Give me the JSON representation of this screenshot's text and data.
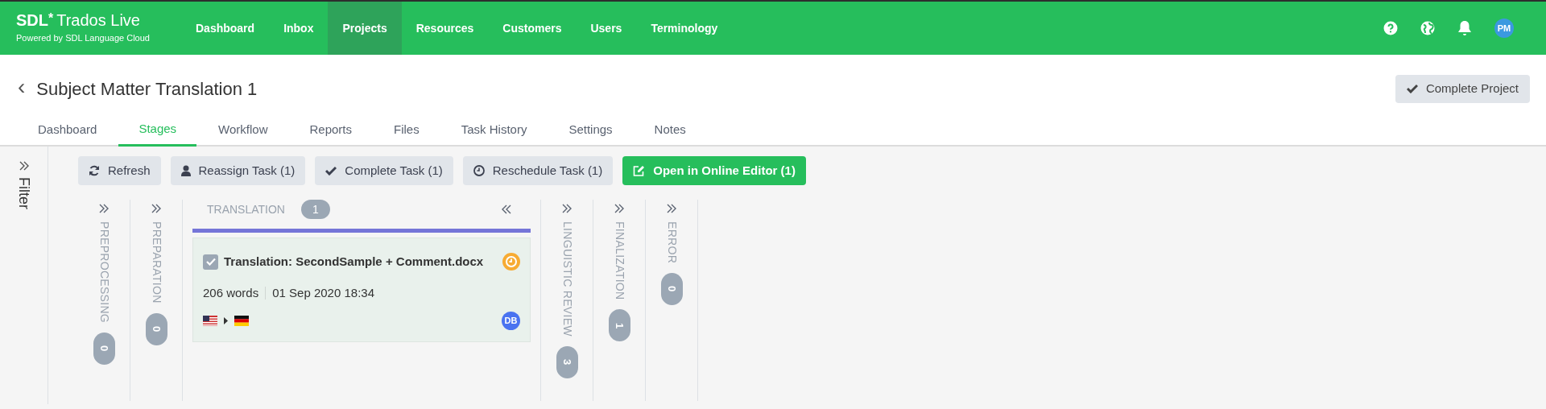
{
  "header": {
    "logo": {
      "brand": "SDL",
      "mark": "*",
      "product": "Trados Live",
      "tagline": "Powered by SDL Language Cloud"
    },
    "nav": [
      {
        "label": "Dashboard",
        "selected": false
      },
      {
        "label": "Inbox",
        "selected": false
      },
      {
        "label": "Projects",
        "selected": true
      },
      {
        "label": "Resources",
        "selected": false
      },
      {
        "label": "Customers",
        "selected": false
      },
      {
        "label": "Users",
        "selected": false
      },
      {
        "label": "Terminology",
        "selected": false
      }
    ],
    "user_initials": "PM"
  },
  "project": {
    "back": "‹",
    "title": "Subject Matter Translation 1",
    "complete_button": "Complete Project"
  },
  "tabs": [
    {
      "label": "Dashboard",
      "selected": false
    },
    {
      "label": "Stages",
      "selected": true
    },
    {
      "label": "Workflow",
      "selected": false
    },
    {
      "label": "Reports",
      "selected": false
    },
    {
      "label": "Files",
      "selected": false
    },
    {
      "label": "Task History",
      "selected": false
    },
    {
      "label": "Settings",
      "selected": false
    },
    {
      "label": "Notes",
      "selected": false
    }
  ],
  "filter": {
    "label": "Filter"
  },
  "toolbar": [
    {
      "label": "Refresh",
      "kind": "secondary"
    },
    {
      "label": "Reassign Task (1)",
      "kind": "secondary"
    },
    {
      "label": "Complete Task (1)",
      "kind": "secondary"
    },
    {
      "label": "Reschedule Task (1)",
      "kind": "secondary"
    },
    {
      "label": "Open in Online Editor (1)",
      "kind": "primary"
    }
  ],
  "stages": [
    {
      "name": "PREPROCESSING",
      "count": "0",
      "expanded": false
    },
    {
      "name": "PREPARATION",
      "count": "0",
      "expanded": false
    },
    {
      "name": "TRANSLATION",
      "count": "1",
      "expanded": true,
      "tasks": [
        {
          "title": "Translation: SecondSample + Comment.docx",
          "checked": true,
          "words": "206 words",
          "date": "01 Sep 2020 18:34",
          "assignee": "DB"
        }
      ]
    },
    {
      "name": "LINGUISTIC REVIEW",
      "count": "3",
      "expanded": false
    },
    {
      "name": "FINALIZATION",
      "count": "1",
      "expanded": false
    },
    {
      "name": "ERROR",
      "count": "0",
      "expanded": false
    }
  ]
}
